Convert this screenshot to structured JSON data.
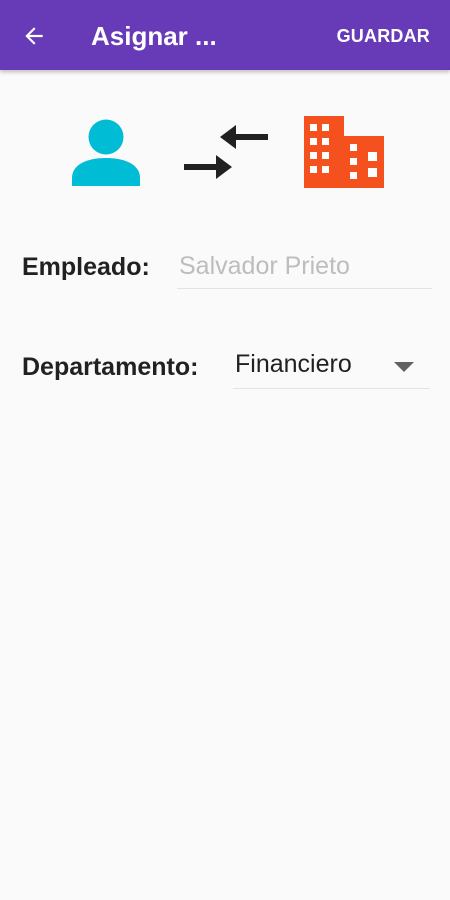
{
  "app_bar": {
    "title": "Asignar ...",
    "save_label": "GUARDAR",
    "back_icon": "arrow-back-icon",
    "color": "#673ab7"
  },
  "icons": {
    "employee": {
      "name": "person-icon",
      "color": "#00bcd4"
    },
    "assign": {
      "name": "swap-arrows-icon",
      "color": "#212121"
    },
    "department": {
      "name": "building-icon",
      "color": "#f4511e"
    }
  },
  "form": {
    "employee_label": "Empleado:",
    "employee_placeholder": "Salvador Prieto",
    "department_label": "Departamento:",
    "department_value": "Financiero"
  }
}
